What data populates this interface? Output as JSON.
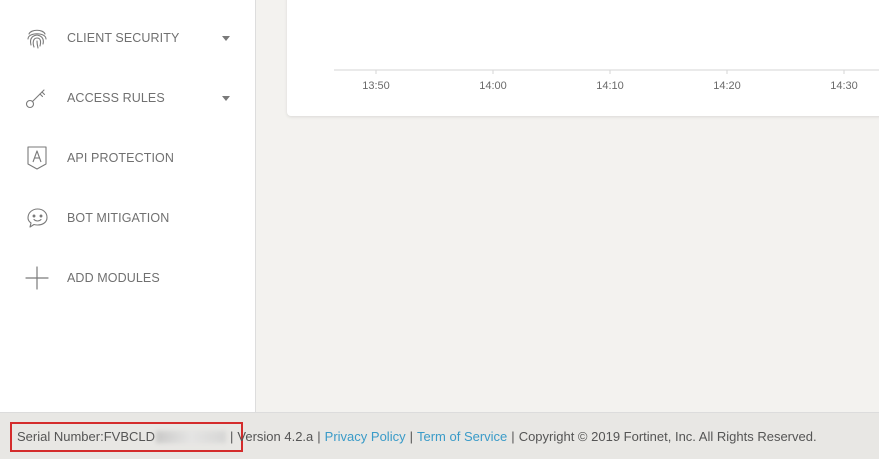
{
  "sidebar": {
    "items": [
      {
        "label": "CLIENT SECURITY",
        "icon": "fingerprint-icon",
        "has_dropdown": true
      },
      {
        "label": "ACCESS RULES",
        "icon": "key-icon",
        "has_dropdown": true
      },
      {
        "label": "API PROTECTION",
        "icon": "api-shield-icon",
        "has_dropdown": false
      },
      {
        "label": "BOT MITIGATION",
        "icon": "bot-face-icon",
        "has_dropdown": false
      },
      {
        "label": "ADD MODULES",
        "icon": "plus-icon",
        "has_dropdown": false
      }
    ]
  },
  "chart": {
    "x_ticks": [
      "13:50",
      "14:00",
      "14:10",
      "14:20",
      "14:30"
    ]
  },
  "footer": {
    "serial_label": "Serial Number: ",
    "serial_value": "FVBCLD",
    "version": "Version 4.2.a",
    "divider": "|",
    "privacy_link": "Privacy Policy",
    "terms_link": "Term of Service",
    "copyright": "Copyright © 2019 Fortinet, Inc. All Rights Reserved."
  },
  "colors": {
    "link": "#3a9bc8",
    "highlight_box": "#d42c2c"
  }
}
